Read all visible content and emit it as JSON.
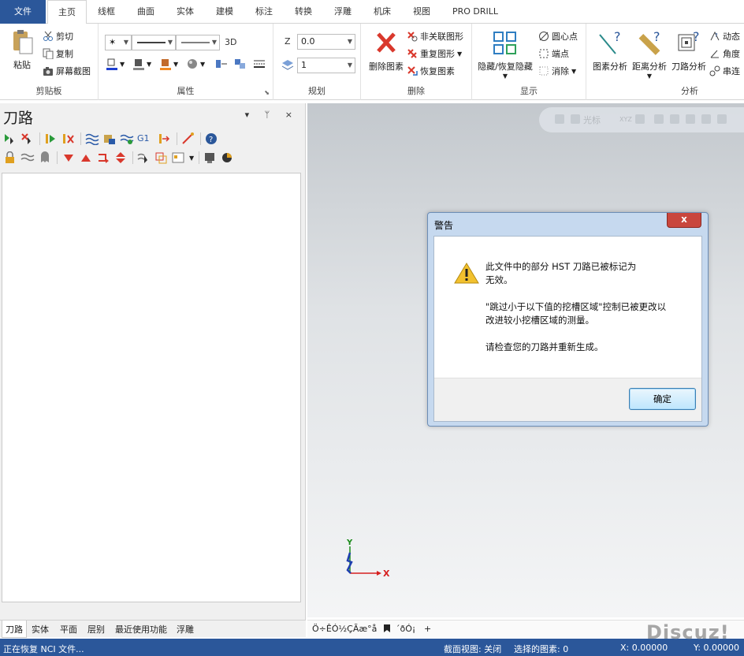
{
  "ribbon_tabs": [
    "文件",
    "主页",
    "线框",
    "曲面",
    "实体",
    "建模",
    "标注",
    "转换",
    "浮雕",
    "机床",
    "视图",
    "PRO DRILL"
  ],
  "ribbon": {
    "clipboard": {
      "label": "剪贴板",
      "paste": "粘贴",
      "cut": "剪切",
      "copy": "复制",
      "screenshot": "屏幕截图"
    },
    "attributes": {
      "label": "属性",
      "mode_3d": "3D"
    },
    "planning": {
      "label": "规划",
      "z_label": "Z",
      "z_value": "0.0",
      "level_value": "1"
    },
    "delete": {
      "label": "删除",
      "delete_entity": "删除图素",
      "non_assoc": "非关联图形",
      "duplicate": "重复图形",
      "restore": "恢复图素"
    },
    "display": {
      "label": "显示",
      "hide_restore": "隐藏/恢复隐藏",
      "center_point": "圆心点",
      "endpoints": "端点",
      "clear": "消除"
    },
    "analysis": {
      "label": "分析",
      "entity_analysis": "图素分析",
      "distance_analysis": "距离分析",
      "toolpath_analysis": "刀路分析",
      "dynamic": "动态",
      "angle": "角度",
      "chain": "串连"
    }
  },
  "panel": {
    "title": "刀路",
    "controls": "▾ ᛘ ×",
    "toolbar_g1": "G1"
  },
  "panel_tabs": [
    "刀路",
    "实体",
    "平面",
    "层别",
    "最近使用功能",
    "浮雕"
  ],
  "viewport": {
    "quickbar_text": "光标",
    "quickbar_xyz": "XYZ",
    "axis_x": "X",
    "axis_y": "Y"
  },
  "viewport_tabs": [
    "Ö÷ÊÓ½ÇÃæ°å",
    "´ðÓ¡",
    "+"
  ],
  "status": {
    "message": "正在恢复 NCI 文件...",
    "section_view": "截面视图: 关闭",
    "selected": "选择的图素: 0",
    "x_coord": "X:   0.00000",
    "y_coord": "Y:   0.00000"
  },
  "dialog": {
    "title": "警告",
    "close": "x",
    "line1": "此文件中的部分 HST 刀路已被标记为",
    "line2": "无效。",
    "line3": "\"跳过小于以下值的挖槽区域\"控制已被更改以",
    "line4": "改进较小挖槽区域的测量。",
    "line5": "请检查您的刀路并重新生成。",
    "ok": "确定"
  },
  "watermark": "Discuz!",
  "colors": {
    "file_tab": "#2b579a",
    "status_bar": "#2b579a",
    "close_button": "#c9463d",
    "delete_red": "#d9382c",
    "axis_x": "#d62020",
    "axis_y": "#1a8a1a",
    "axis_z": "#1f3fb0"
  }
}
